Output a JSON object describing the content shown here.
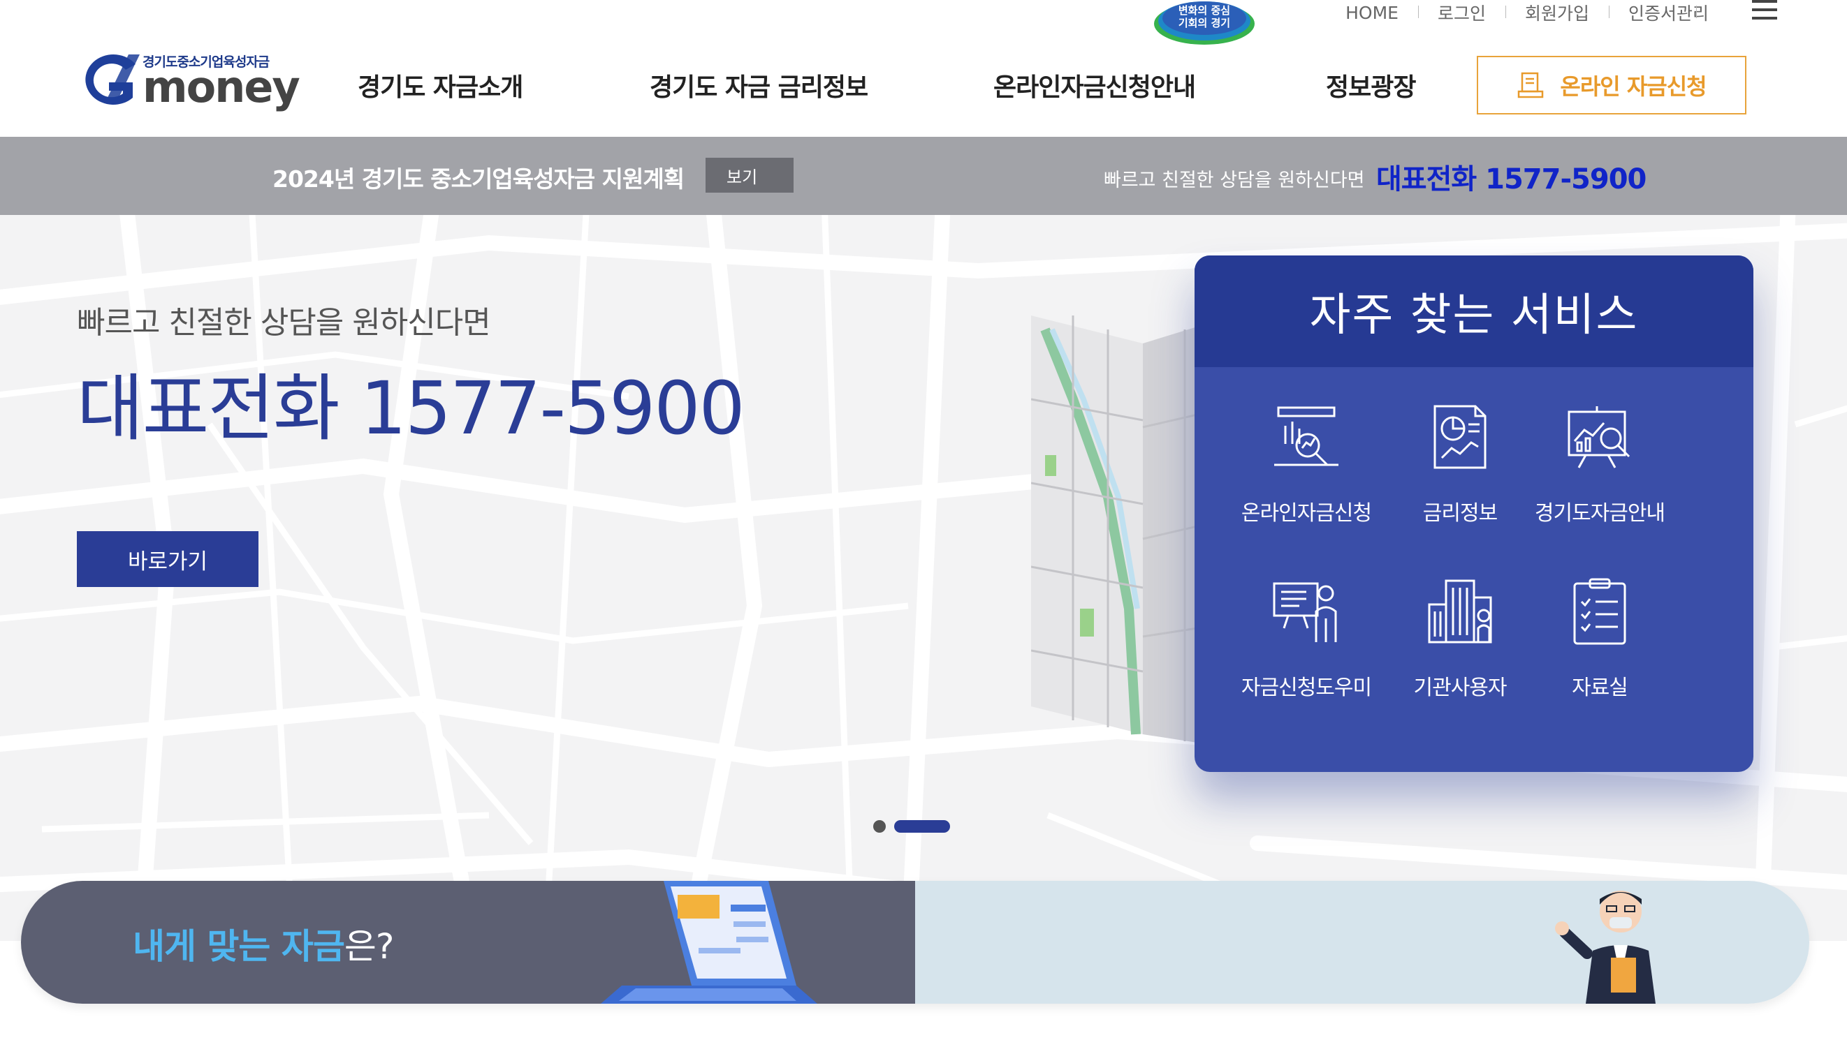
{
  "header": {
    "logo_subtitle": "경기도중소기업육성자금",
    "logo_text": "money",
    "badge_line1": "변화의 중심",
    "badge_line2": "기회의 경기",
    "util_links": [
      "HOME",
      "로그인",
      "회원가입",
      "인증서관리"
    ],
    "nav": [
      "경기도 자금소개",
      "경기도 자금 금리정보",
      "온라인자금신청안내",
      "정보광장"
    ],
    "apply_button": "온라인 자금신청"
  },
  "notice": {
    "title": "2024년 경기도 중소기업육성자금 지원계획",
    "view_button": "보기",
    "consult_text": "빠르고 친절한 상담을 원하신다면",
    "phone": "대표전화 1577-5900"
  },
  "hero": {
    "subtitle": "빠르고 친절한 상담을 원하신다면",
    "phone": "대표전화 1577-5900",
    "go_button": "바로가기"
  },
  "services": {
    "title": "자주 찾는 서비스",
    "items": [
      {
        "label": "온라인자금신청",
        "icon": "online-application-icon"
      },
      {
        "label": "금리정보",
        "icon": "rate-info-icon"
      },
      {
        "label": "경기도자금안내",
        "icon": "fund-guide-icon"
      },
      {
        "label": "자금신청도우미",
        "icon": "application-helper-icon"
      },
      {
        "label": "기관사용자",
        "icon": "institution-user-icon"
      },
      {
        "label": "자료실",
        "icon": "archive-icon"
      }
    ]
  },
  "slider": {
    "slide_count": 2,
    "active_slide": 2
  },
  "banner": {
    "highlight": "내게 맞는 자금",
    "rest": "은?"
  },
  "colors": {
    "brand_navy": "#2a3d96",
    "panel_blue": "#3a4ea8",
    "accent_orange": "#e89a2b",
    "phone_blue": "#1024c8",
    "notice_gray": "#a2a3a8"
  }
}
